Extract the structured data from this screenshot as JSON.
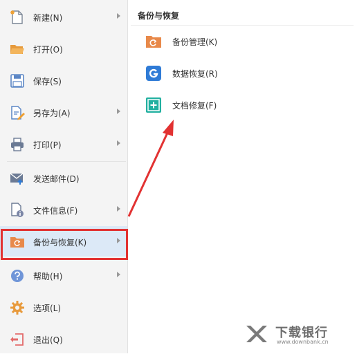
{
  "menu": {
    "items": [
      {
        "label": "新建(N)",
        "icon": "new-file-icon",
        "has_submenu": true
      },
      {
        "label": "打开(O)",
        "icon": "open-folder-icon",
        "has_submenu": false
      },
      {
        "label": "保存(S)",
        "icon": "save-icon",
        "has_submenu": false
      },
      {
        "label": "另存为(A)",
        "icon": "save-as-icon",
        "has_submenu": true
      },
      {
        "label": "打印(P)",
        "icon": "printer-icon",
        "has_submenu": true
      },
      {
        "label": "发送邮件(D)",
        "icon": "mail-icon",
        "has_submenu": false
      },
      {
        "label": "文件信息(F)",
        "icon": "file-info-icon",
        "has_submenu": true
      },
      {
        "label": "备份与恢复(K)",
        "icon": "backup-folder-icon",
        "has_submenu": true,
        "selected": true
      },
      {
        "label": "帮助(H)",
        "icon": "help-icon",
        "has_submenu": true
      },
      {
        "label": "选项(L)",
        "icon": "gear-icon",
        "has_submenu": false
      },
      {
        "label": "退出(Q)",
        "icon": "exit-icon",
        "has_submenu": false
      }
    ]
  },
  "submenu": {
    "title": "备份与恢复",
    "items": [
      {
        "label": "备份管理(K)",
        "icon": "backup-manage-icon"
      },
      {
        "label": "数据恢复(R)",
        "icon": "data-recovery-icon"
      },
      {
        "label": "文档修复(F)",
        "icon": "document-repair-icon"
      }
    ]
  },
  "watermark": {
    "title": "下载银行",
    "url": "www.downbank.cn"
  },
  "colors": {
    "selected_bg": "#dce9f7",
    "highlight": "#e23232",
    "accent_orange": "#e8894a",
    "accent_blue": "#2f7bd6",
    "accent_teal": "#22b0a0"
  }
}
